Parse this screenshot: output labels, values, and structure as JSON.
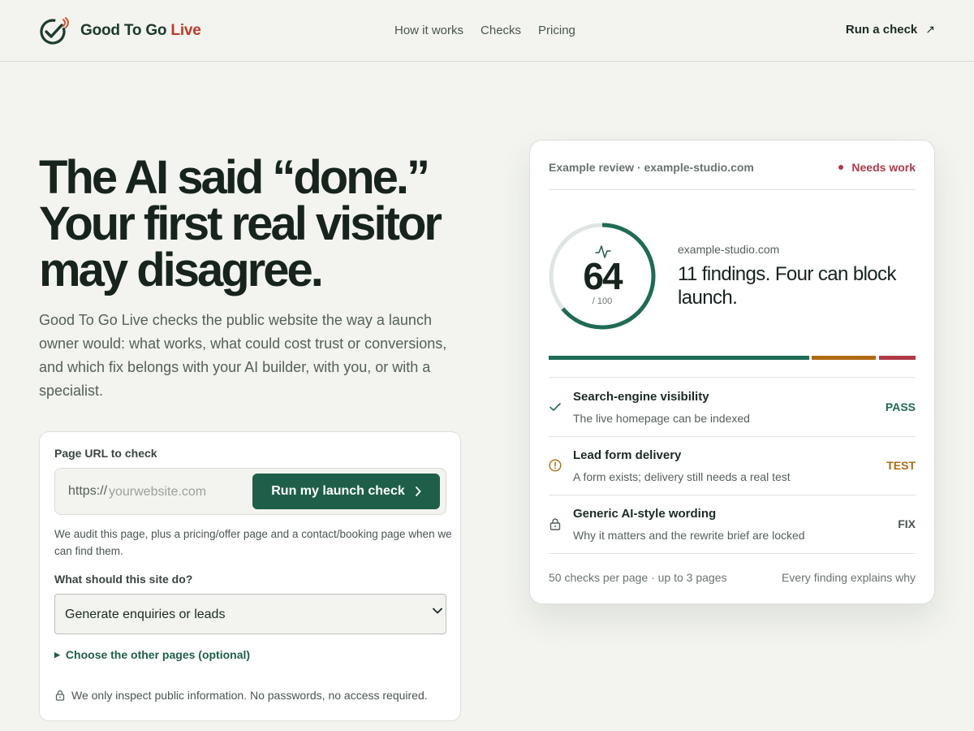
{
  "brand": {
    "name_part1": "Good To Go ",
    "name_part2": "Live"
  },
  "nav": {
    "items": [
      "How it works",
      "Checks",
      "Pricing"
    ],
    "cta": "Run a check",
    "cta_icon": "arrow-up-right-icon"
  },
  "hero": {
    "title_lines": [
      "The AI said “done.”",
      "Your first real visitor",
      "may disagree."
    ],
    "subtitle": "Good To Go Live checks the public website the way a launch owner would: what works, what could cost trust or conversions, and which fix belongs with your AI builder, with you, or with a specialist."
  },
  "form": {
    "url_label": "Page URL to check",
    "url_prefix": "https://",
    "url_placeholder": "yourwebsite.com",
    "submit_label": "Run my launch check",
    "note": "We audit this page, plus a pricing/offer page and a contact/booking page when we can find them.",
    "goal_label": "What should this site do?",
    "goal_selected": "Generate enquiries or leads",
    "choose_pages": "Choose the other pages (optional)",
    "privacy": "We only inspect public information. No passwords, no access required."
  },
  "review": {
    "header": "Example review · example-studio.com",
    "status": "Needs work",
    "score": "64",
    "score_max": "/ 100",
    "score_value": 64,
    "site": "example-studio.com",
    "findings": "11 findings. Four can block launch.",
    "severity_colors": {
      "pass": "#1f6b55",
      "test": "#b06a12",
      "fix": "#b03a48"
    },
    "checks": [
      {
        "title": "Search-engine visibility",
        "desc": "The live homepage can be indexed",
        "status": "PASS",
        "icon": "check-icon",
        "color": "#1f6b55"
      },
      {
        "title": "Lead form delivery",
        "desc": "A form exists; delivery still needs a real test",
        "status": "TEST",
        "icon": "warning-circle-icon",
        "color": "#b06a12"
      },
      {
        "title": "Generic AI-style wording",
        "desc": "Why it matters and the rewrite brief are locked",
        "status": "FIX",
        "icon": "lock-icon",
        "color": "#4a5550"
      }
    ],
    "footer_left": "50 checks per page · up to 3 pages",
    "footer_right": "Every finding explains why"
  },
  "colors": {
    "accent": "#1f5f4a",
    "brand_red": "#c0392b",
    "background": "#f3f4ef"
  }
}
